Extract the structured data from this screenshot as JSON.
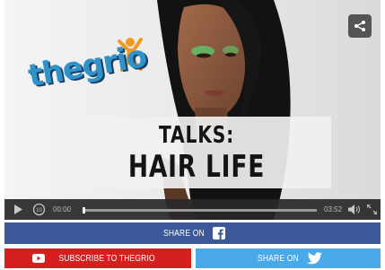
{
  "player": {
    "logo_text": "thegrio",
    "title_line1": "TALKS:",
    "title_line2": "HAIR LIFE",
    "current_time": "00:00",
    "duration": "03:52",
    "progress_fraction": 0.0
  },
  "share_facebook": {
    "label": "SHARE ON"
  },
  "subscribe_youtube": {
    "label": "SUBSCRIBE TO THEGRIO"
  },
  "share_twitter": {
    "label": "SHARE ON"
  },
  "colors": {
    "facebook": "#3b5998",
    "youtube": "#d61f1f",
    "twitter": "#4aa9e8"
  },
  "icons": [
    "share-icon",
    "play-icon",
    "rewind-10-icon",
    "volume-icon",
    "fullscreen-icon",
    "facebook-icon",
    "youtube-icon",
    "twitter-icon"
  ]
}
